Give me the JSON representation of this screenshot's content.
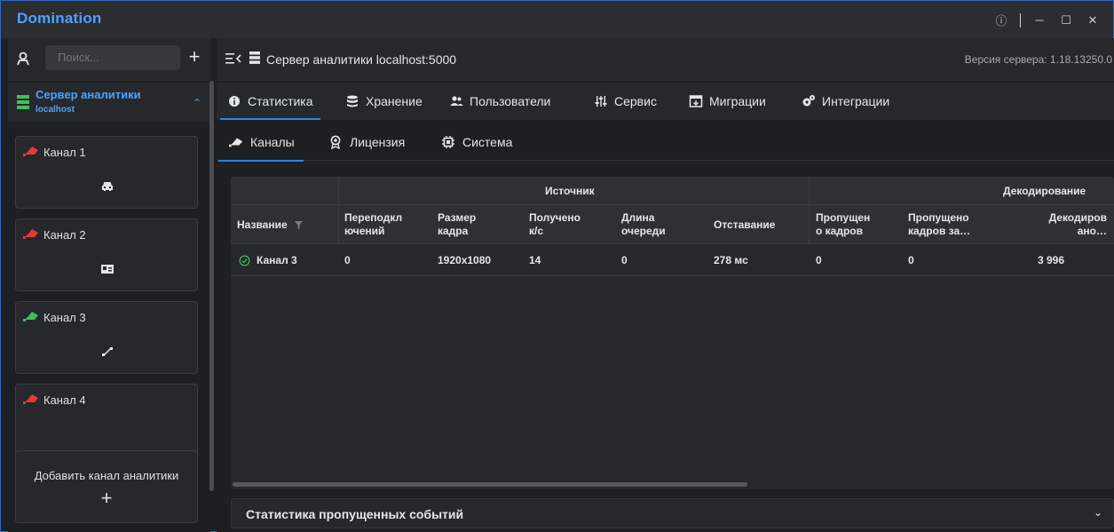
{
  "app": {
    "title": "Domination"
  },
  "window": {
    "info": "ⓘ",
    "minimize": "─",
    "maximize": "☐",
    "close": "✕"
  },
  "sidebar": {
    "search_placeholder": "Поиск...",
    "add": "+",
    "server": {
      "name": "Сервер аналитики",
      "host": "localhost",
      "chevron": "⌃"
    },
    "channels": [
      {
        "label": "Канал 1",
        "status": "red",
        "icon": "car-icon"
      },
      {
        "label": "Канал 2",
        "status": "red",
        "icon": "id-card-icon"
      },
      {
        "label": "Канал 3",
        "status": "green",
        "icon": "resize-icon"
      },
      {
        "label": "Канал 4",
        "status": "red",
        "icon": ""
      }
    ],
    "add_channel": {
      "label": "Добавить канал аналитики",
      "plus": "+"
    }
  },
  "header": {
    "title": "Сервер аналитики  localhost:5000",
    "version": "Версия сервера: 1.18.13250.0"
  },
  "tabs": [
    {
      "label": "Статистика",
      "active": true
    },
    {
      "label": "Хранение"
    },
    {
      "label": "Пользователи"
    },
    {
      "label": "Сервис"
    },
    {
      "label": "Миграции"
    },
    {
      "label": "Интеграции"
    }
  ],
  "subtabs": [
    {
      "label": "Каналы",
      "active": true
    },
    {
      "label": "Лицензия"
    },
    {
      "label": "Система"
    }
  ],
  "table": {
    "groups": {
      "source": "Источник",
      "decoding": "Декодирование"
    },
    "columns": {
      "name": "Название",
      "reconnects": "Переподкл ючений",
      "frame_size": "Размер кадра",
      "received": "Получено к/с",
      "queue": "Длина очереди",
      "lag": "Отставание",
      "skipped": "Пропущен о кадров",
      "skipped_for": "Пропущено кадров за…",
      "decoded": "Декодиров ано…"
    },
    "rows": [
      {
        "name": "Канал 3",
        "reconnects": "0",
        "frame_size": "1920x1080",
        "received": "14",
        "queue": "0",
        "lag": "278 мс",
        "skipped": "0",
        "skipped_for": "0",
        "decoded": "3 996"
      }
    ]
  },
  "events": {
    "label": "Статистика пропущенных событий",
    "chevron": "⌄"
  },
  "colors": {
    "accent": "#4da3ff",
    "tab_underline": "#2f80ed",
    "ok": "#3fbf5a",
    "alert": "#e53935"
  }
}
